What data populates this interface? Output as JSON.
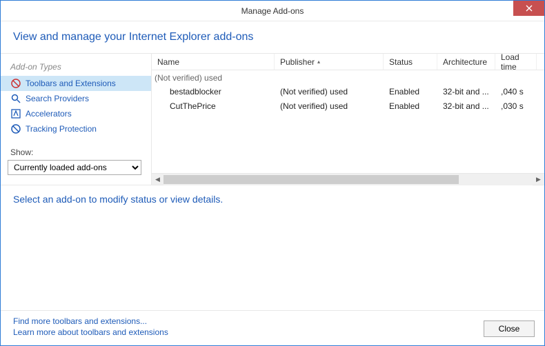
{
  "window": {
    "title": "Manage Add-ons"
  },
  "header": {
    "title": "View and manage your Internet Explorer add-ons"
  },
  "sidebar": {
    "heading": "Add-on Types",
    "items": [
      {
        "label": "Toolbars and Extensions"
      },
      {
        "label": "Search Providers"
      },
      {
        "label": "Accelerators"
      },
      {
        "label": "Tracking Protection"
      }
    ],
    "show_label": "Show:",
    "show_value": "Currently loaded add-ons"
  },
  "columns": [
    "Name",
    "Publisher",
    "Status",
    "Architecture",
    "Load time"
  ],
  "group_label": "(Not verified) used",
  "rows": [
    {
      "name": "bestadblocker",
      "publisher": "(Not verified) used",
      "status": "Enabled",
      "arch": "32-bit and ...",
      "load": ",040 s"
    },
    {
      "name": "CutThePrice",
      "publisher": "(Not verified) used",
      "status": "Enabled",
      "arch": "32-bit and ...",
      "load": ",030 s"
    }
  ],
  "details": {
    "text": "Select an add-on to modify status or view details."
  },
  "footer": {
    "link1": "Find more toolbars and extensions...",
    "link2": "Learn more about toolbars and extensions",
    "close_label": "Close"
  }
}
